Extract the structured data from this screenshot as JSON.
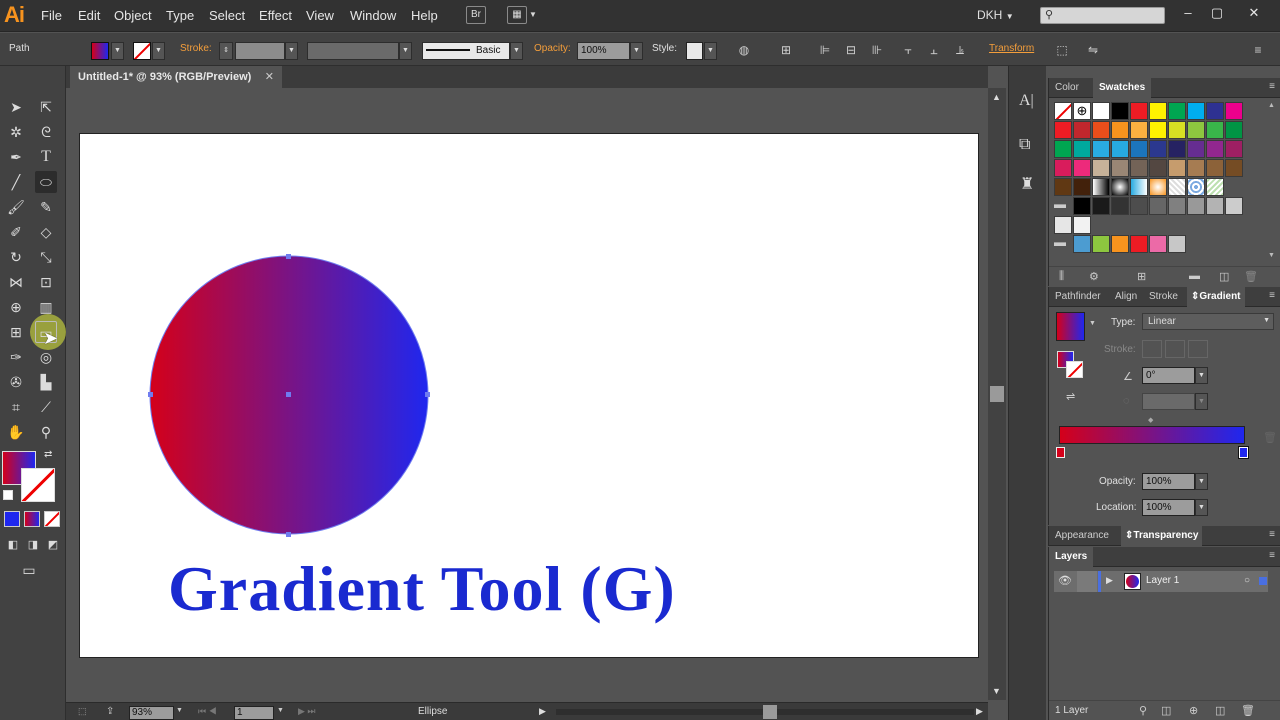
{
  "app": {
    "logo": "Ai"
  },
  "menu": [
    "File",
    "Edit",
    "Object",
    "Type",
    "Select",
    "Effect",
    "View",
    "Window",
    "Help"
  ],
  "menubar": {
    "bridge_btn": "Br",
    "workspace": "DKH",
    "search_placeholder": ""
  },
  "control": {
    "selection_label": "Path",
    "stroke_label": "Stroke:",
    "brush_label": "Basic",
    "opacity_label": "Opacity:",
    "opacity_value": "100%",
    "style_label": "Style:",
    "transform_label": "Transform"
  },
  "document": {
    "tab_title": "Untitled-1* @ 93% (RGB/Preview)"
  },
  "artwork": {
    "heading": "Gradient Tool (G)",
    "gradient_start": "#d4001a",
    "gradient_end": "#1f27ef",
    "text_color": "#1a2ad0"
  },
  "status": {
    "zoom": "93%",
    "page": "1",
    "tool_name": "Ellipse"
  },
  "panels": {
    "color_tabs": [
      "Color",
      "Swatches"
    ],
    "active_color_tab": "Swatches",
    "pathfinder_tabs": [
      "Pathfinder",
      "Align",
      "Stroke",
      "Gradient"
    ],
    "active_pathfinder_tab": "Gradient",
    "gradient": {
      "type_label": "Type:",
      "type_value": "Linear",
      "stroke_label": "Stroke:",
      "angle_value": "0°",
      "opacity_label": "Opacity:",
      "opacity_value": "100%",
      "location_label": "Location:",
      "location_value": "100%"
    },
    "appearance_tabs": [
      "Appearance",
      "Transparency"
    ],
    "layers_tab": "Layers",
    "layer": {
      "name": "Layer 1"
    },
    "layers_count": "1 Layer"
  },
  "swatch_colors": [
    [
      "none",
      "reg",
      "#ffffff",
      "#000000",
      "#ed1c24",
      "#fff200",
      "#00a651",
      "#00aeef",
      "#2e3192",
      "#ec008c"
    ],
    [
      "#ed1c24",
      "#c1272d",
      "#e94e1b",
      "#f7931e",
      "#fbb040",
      "#fff200",
      "#d7df23",
      "#8dc63f",
      "#39b54a",
      "#009444"
    ],
    [
      "#00a651",
      "#00a99d",
      "#29abe2",
      "#27aae1",
      "#1c75bc",
      "#2b388f",
      "#262262",
      "#662d91",
      "#92278f",
      "#9e1f63"
    ],
    [
      "#d91c5c",
      "#ed2a7b",
      "#c7b299",
      "#998675",
      "#736357",
      "#534741",
      "#c69c6d",
      "#a67c52",
      "#8c6239",
      "#754c24"
    ],
    [
      "#603813",
      "#42210b",
      "grad1",
      "grad2",
      "grad3",
      "grad4",
      "pat1",
      "pat2",
      "pat3",
      ""
    ],
    [
      "folder",
      "#000000",
      "#1a1a1a",
      "#333333",
      "#4d4d4d",
      "#666666",
      "#808080",
      "#999999",
      "#b3b3b3",
      "#cccccc"
    ],
    [
      "#e6e6e6",
      "#f2f2f2",
      "",
      "",
      "",
      "",
      "",
      "",
      "",
      ""
    ],
    [
      "folder",
      "#4c9cd1",
      "#8dc63f",
      "#f7931e",
      "#ed1c24",
      "#ec6aa7",
      "#c7c7c7",
      "",
      "",
      ""
    ]
  ]
}
